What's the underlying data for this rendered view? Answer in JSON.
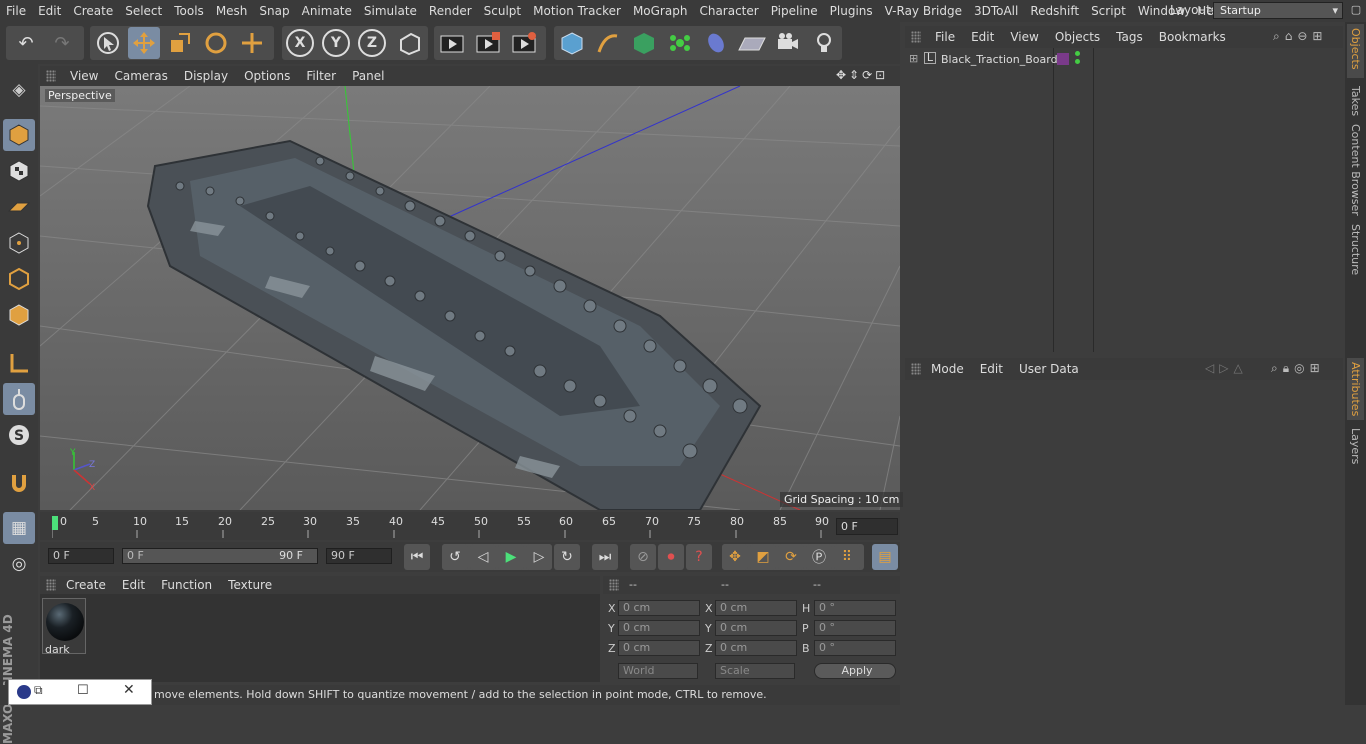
{
  "menu": [
    "File",
    "Edit",
    "Create",
    "Select",
    "Tools",
    "Mesh",
    "Snap",
    "Animate",
    "Simulate",
    "Render",
    "Sculpt",
    "Motion Tracker",
    "MoGraph",
    "Character",
    "Pipeline",
    "Plugins",
    "V-Ray Bridge",
    "3DToAll",
    "Redshift",
    "Script",
    "Window",
    "Help"
  ],
  "layout": {
    "label": "Layout:",
    "value": "Startup"
  },
  "viewport_menu": [
    "View",
    "Cameras",
    "Display",
    "Options",
    "Filter",
    "Panel"
  ],
  "viewport_label": "Perspective",
  "grid_spacing": "Grid Spacing : 10 cm",
  "axis_labels": {
    "y": "Y",
    "z": "Z",
    "x": "X"
  },
  "timeline": {
    "ticks": [
      "0",
      "5",
      "10",
      "15",
      "20",
      "25",
      "30",
      "35",
      "40",
      "45",
      "50",
      "55",
      "60",
      "65",
      "70",
      "75",
      "80",
      "85",
      "90"
    ],
    "current_frame": "0 F"
  },
  "playbar": {
    "start": "0 F",
    "range_start": "0 F",
    "range_end": "90 F",
    "end": "90 F"
  },
  "material_menu": [
    "Create",
    "Edit",
    "Function",
    "Texture"
  ],
  "material": {
    "name": "dark"
  },
  "coords": {
    "headers": [
      "--",
      "--",
      "--"
    ],
    "rows": [
      {
        "a": "X",
        "av": "0 cm",
        "b": "X",
        "bv": "0 cm",
        "c": "H",
        "cv": "0 °"
      },
      {
        "a": "Y",
        "av": "0 cm",
        "b": "Y",
        "bv": "0 cm",
        "c": "P",
        "cv": "0 °"
      },
      {
        "a": "Z",
        "av": "0 cm",
        "b": "Z",
        "bv": "0 cm",
        "c": "B",
        "cv": "0 °"
      }
    ],
    "world": "World",
    "scale": "Scale",
    "apply": "Apply"
  },
  "status_text": "move elements. Hold down SHIFT to quantize movement / add to the selection in point mode, CTRL to remove.",
  "object_menu": [
    "File",
    "Edit",
    "View",
    "Objects",
    "Tags",
    "Bookmarks"
  ],
  "object_tree": [
    {
      "name": "Black_Traction_Board"
    }
  ],
  "attr_menu": [
    "Mode",
    "Edit",
    "User Data"
  ],
  "right_tabs": [
    "Objects",
    "Takes",
    "Content Browser",
    "Structure",
    "Attributes",
    "Layers"
  ],
  "logo": {
    "brand": "MAXON",
    "product": "CINEMA 4D"
  },
  "colors": {
    "selected": "#7a8ca3",
    "accent": "#e0a040",
    "viewport": "#6c6c6c",
    "panel": "#3d3d3d"
  }
}
